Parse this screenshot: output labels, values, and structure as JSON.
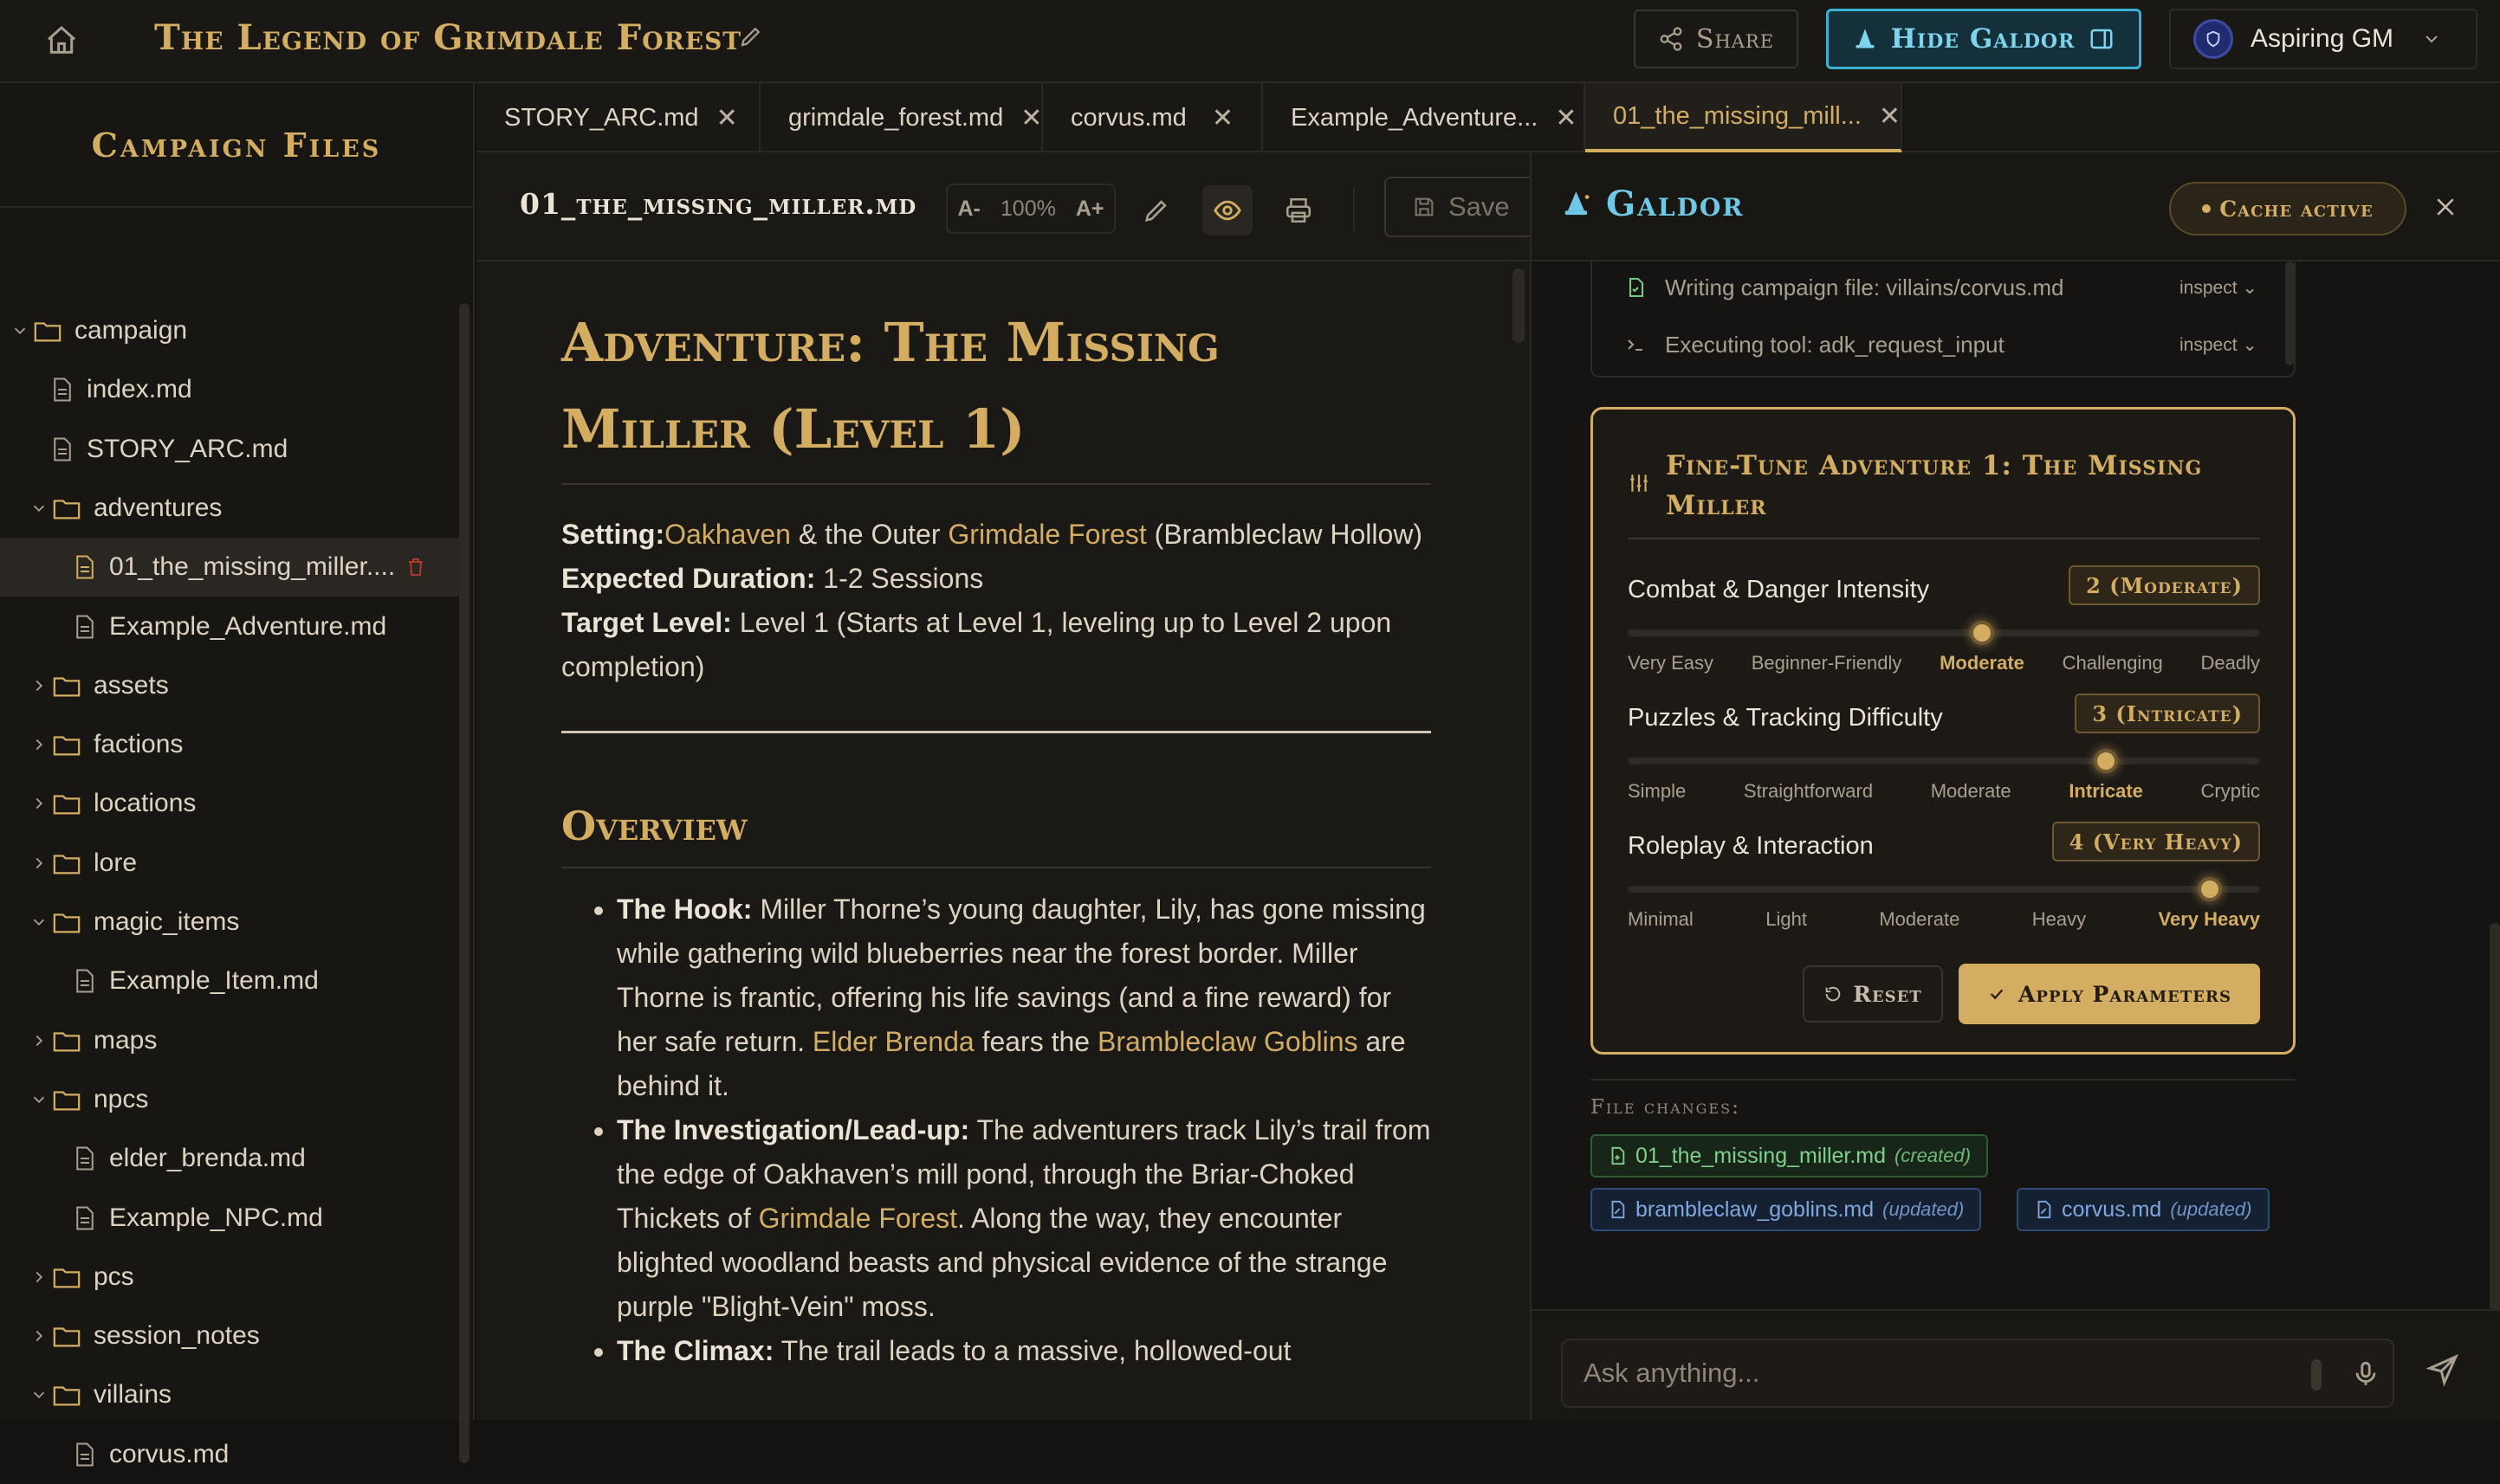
{
  "header": {
    "title": "The Legend of Grimdale Forest",
    "share_label": "Share",
    "hide_label": "Hide Galdor",
    "user_name": "Aspiring GM"
  },
  "sidebar": {
    "title": "Campaign Files",
    "items": [
      {
        "label": "campaign",
        "type": "folder",
        "open": true
      },
      {
        "label": "index.md",
        "type": "file"
      },
      {
        "label": "STORY_ARC.md",
        "type": "file"
      },
      {
        "label": "adventures",
        "type": "folder",
        "open": true
      },
      {
        "label": "01_the_missing_miller....",
        "type": "file",
        "selected": true
      },
      {
        "label": "Example_Adventure.md",
        "type": "file"
      },
      {
        "label": "assets",
        "type": "folder",
        "open": false
      },
      {
        "label": "factions",
        "type": "folder",
        "open": false
      },
      {
        "label": "locations",
        "type": "folder",
        "open": false
      },
      {
        "label": "lore",
        "type": "folder",
        "open": false
      },
      {
        "label": "magic_items",
        "type": "folder",
        "open": true
      },
      {
        "label": "Example_Item.md",
        "type": "file"
      },
      {
        "label": "maps",
        "type": "folder",
        "open": false
      },
      {
        "label": "npcs",
        "type": "folder",
        "open": true
      },
      {
        "label": "elder_brenda.md",
        "type": "file"
      },
      {
        "label": "Example_NPC.md",
        "type": "file"
      },
      {
        "label": "pcs",
        "type": "folder",
        "open": false
      },
      {
        "label": "session_notes",
        "type": "folder",
        "open": false
      },
      {
        "label": "villains",
        "type": "folder",
        "open": true
      },
      {
        "label": "corvus.md",
        "type": "file"
      }
    ]
  },
  "tabs": [
    {
      "label": "STORY_ARC.md"
    },
    {
      "label": "grimdale_forest.md"
    },
    {
      "label": "corvus.md"
    },
    {
      "label": "Example_Adventure..."
    },
    {
      "label": "01_the_missing_mill...",
      "active": true
    }
  ],
  "editor": {
    "filename": "01_the_missing_miller.md",
    "zoom_minus": "A-",
    "zoom_level": "100%",
    "zoom_plus": "A+",
    "save_label": "Save",
    "title_line1": "Adventure: The Missing",
    "title_line2": "Miller (Level 1)",
    "setting_label": "Setting:",
    "setting_link1": "Oakhaven",
    "setting_mid": " & the Outer ",
    "setting_link2": "Grimdale Forest",
    "setting_tail": " (Brambleclaw Hollow)",
    "duration_label": "Expected Duration:",
    "duration_value": " 1-2 Sessions",
    "level_label": "Target Level:",
    "level_value": " Level 1 (Starts at Level 1, leveling up to Level 2 upon completion)",
    "overview_heading": "Overview",
    "hook_label": "The Hook:",
    "hook_text1": " Miller Thorne’s young daughter, Lily, has gone missing while gathering wild blueberries near the forest border. Miller Thorne is frantic, offering his life savings (and a fine reward) for her safe return. ",
    "hook_link1": "Elder Brenda",
    "hook_text2": " fears the ",
    "hook_link2": "Brambleclaw Goblins",
    "hook_text3": " are behind it.",
    "invest_label": "The Investigation/Lead-up:",
    "invest_text1": " The adventurers track Lily’s trail from the edge of Oakhaven’s mill pond, through the Briar-Choked Thickets of ",
    "invest_link": "Grimdale Forest",
    "invest_text2": ". Along the way, they encounter blighted woodland beasts and physical evidence of the strange purple \"Blight-Vein\" moss.",
    "climax_label": "The Climax:",
    "climax_text": " The trail leads to a massive, hollowed-out"
  },
  "assistant": {
    "name": "Galdor",
    "cache_label": "Cache active",
    "log": [
      {
        "text": "Writing campaign file: villains/corvus.md",
        "action": "inspect"
      },
      {
        "text": "Executing tool: adk_request_input",
        "action": "inspect"
      }
    ],
    "card_title": "Fine-Tune Adventure 1: The Missing Miller",
    "params": [
      {
        "label": "Combat & Danger Intensity",
        "badge": "2 (Moderate)",
        "value": 3,
        "ticks": [
          "Very Easy",
          "Beginner-Friendly",
          "Moderate",
          "Challenging",
          "Deadly"
        ]
      },
      {
        "label": "Puzzles & Tracking Difficulty",
        "badge": "3 (Intricate)",
        "value": 4,
        "ticks": [
          "Simple",
          "Straightforward",
          "Moderate",
          "Intricate",
          "Cryptic"
        ]
      },
      {
        "label": "Roleplay & Interaction",
        "badge": "4 (Very Heavy)",
        "value": 5,
        "ticks": [
          "Minimal",
          "Light",
          "Moderate",
          "Heavy",
          "Very Heavy"
        ]
      }
    ],
    "reset_label": "Reset",
    "apply_label": "Apply Parameters",
    "file_changes_label": "File changes:",
    "changes": [
      {
        "file": "01_the_missing_miller.md",
        "status": "(created)"
      },
      {
        "file": "brambleclaw_goblins.md",
        "status": "(updated)"
      },
      {
        "file": "corvus.md",
        "status": "(updated)"
      }
    ],
    "input_placeholder": "Ask anything..."
  },
  "colors": {
    "accent": "#d3ad62",
    "galdor": "#6fc9e6",
    "created": "#7fd08a",
    "updated": "#7fa8e0",
    "delete": "#c0392b"
  }
}
